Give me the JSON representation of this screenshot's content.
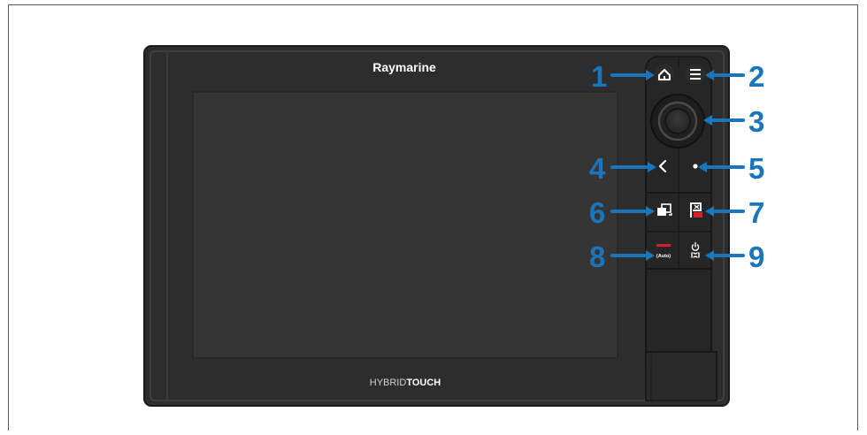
{
  "device": {
    "brand": "Raymarine",
    "bottom_logo_light": "HYBRID",
    "bottom_logo_bold": "TOUCH"
  },
  "callouts": {
    "home": "1",
    "menu": "2",
    "joystick": "3",
    "back": "4",
    "ok": "5",
    "switch_panes": "6",
    "waypoint_mob": "7",
    "pilot": "8",
    "power": "9"
  },
  "button_text": {
    "pilot_auto": "(Auto)"
  },
  "colors": {
    "callout_blue": "#1a75bb",
    "bezel": "#2b2b2b",
    "screen": "#333333",
    "red_accent": "#d8202a"
  },
  "icons": {
    "home": "home-icon",
    "menu": "hamburger-menu-icon",
    "joystick": "uniController-joystick-icon",
    "back": "chevron-left-icon",
    "ok": "dot-icon",
    "switch_panes": "switch-panes-icon",
    "waypoint_mob": "waypoint-mob-icon",
    "pilot": "autopilot-icon",
    "power": "power-icon"
  }
}
